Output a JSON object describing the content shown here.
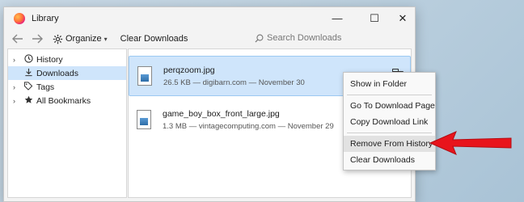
{
  "window": {
    "title": "Library",
    "controls": {
      "minimize": "—",
      "maximize": "☐",
      "close": "✕"
    }
  },
  "toolbar": {
    "back_icon": "arrow-left-icon",
    "forward_icon": "arrow-right-icon",
    "organize_label": "Organize",
    "clear_downloads_label": "Clear Downloads",
    "search_placeholder": "Search Downloads"
  },
  "sidebar": {
    "items": [
      {
        "label": "History",
        "icon": "clock-icon",
        "twisty": "›",
        "selected": false
      },
      {
        "label": "Downloads",
        "icon": "download-icon",
        "twisty": "",
        "selected": true
      },
      {
        "label": "Tags",
        "icon": "tag-icon",
        "twisty": "›",
        "selected": false
      },
      {
        "label": "All Bookmarks",
        "icon": "star-icon",
        "twisty": "›",
        "selected": false
      }
    ]
  },
  "downloads": [
    {
      "name": "perqzoom.jpg",
      "meta": "26.5 KB — digibarn.com — November 30",
      "selected": true
    },
    {
      "name": "game_boy_box_front_large.jpg",
      "meta": "1.3 MB — vintagecomputing.com — November 29",
      "selected": false
    }
  ],
  "context_menu": {
    "items": [
      {
        "label": "Show in Folder"
      },
      {
        "label": "Go To Download Page"
      },
      {
        "label": "Copy Download Link"
      },
      {
        "label": "Remove From History"
      },
      {
        "label": "Clear Downloads"
      }
    ]
  },
  "colors": {
    "selection": "#cfe5fb",
    "arrow": "#e8141c"
  }
}
